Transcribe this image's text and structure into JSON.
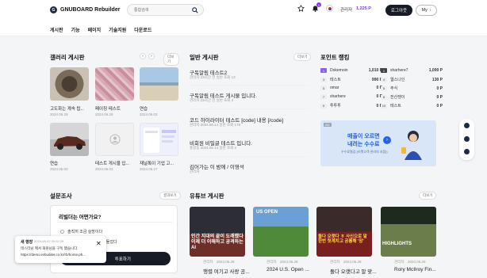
{
  "header": {
    "logo_text": "GNUBOARD Rebuilder",
    "search_placeholder": "통합검색",
    "notification_count": "1",
    "manager_label": "관리자",
    "points": "1,225 P",
    "logout_label": "로그아웃",
    "my_label": "My"
  },
  "nav": [
    "게시판",
    "기능",
    "페이지",
    "기술지원",
    "다운로드"
  ],
  "gallery": {
    "title": "갤러리 게시판",
    "more": "더보기",
    "items": [
      {
        "caption": "고도화는 계속 됩...",
        "date": "2024.06.29"
      },
      {
        "caption": "페이징 테스트",
        "date": "2024.06.28"
      },
      {
        "caption": "연습",
        "date": "2024.06.03"
      },
      {
        "caption": "연습",
        "date": "2024.06.03"
      },
      {
        "caption": "테스트 게시물 입...",
        "date": "2024.06.03"
      },
      {
        "caption": "재널톡이 기업 고...",
        "date": "2024.05.27"
      }
    ]
  },
  "board": {
    "title": "일반 게시판",
    "more": "더보기",
    "posts": [
      {
        "title": "구독알림 테스트2",
        "meta": "관리자   23시간 전   일반   조회 13"
      },
      {
        "title": "구독알림 테스트 게시물 입니다.",
        "meta": "관리자   23시간 전   일반   조회 4"
      },
      {
        "title": "코드 하이라이터 테스트 [code] 내용 [/code]",
        "meta": "관리자   2024.06.14   일반   조회 179"
      },
      {
        "title": "비회원 비밀글 테스트 입니다.",
        "meta": "홍길동   2024.06.14   일반   조회 2"
      },
      {
        "title": "김어가는 이 밤에 / 이영석",
        "meta": "관리자"
      }
    ]
  },
  "ranking": {
    "title": "포인트 랭킹",
    "rows": [
      {
        "num": "1",
        "name": "Dokemoin",
        "pts": "1,010 P"
      },
      {
        "num": "2",
        "name": "sharhere7",
        "pts": "1,000 P"
      },
      {
        "num": "3",
        "name": "테스트",
        "pts": "990 P"
      },
      {
        "num": "4",
        "name": "웹스나인",
        "pts": "130 P"
      },
      {
        "num": "5",
        "name": "omar",
        "pts": "0 P"
      },
      {
        "num": "6",
        "name": "주식",
        "pts": "0 P"
      },
      {
        "num": "7",
        "name": "sharhere",
        "pts": "0 P"
      },
      {
        "num": "8",
        "name": "전산쟁이",
        "pts": "0 P"
      },
      {
        "num": "9",
        "name": "투투투",
        "pts": "0 P"
      },
      {
        "num": "10",
        "name": "테스트",
        "pts": "0 P"
      }
    ]
  },
  "ad": {
    "tag": "AD",
    "headline1": "매출이 오르면",
    "headline2": "내려는 수수료",
    "sub": "수수료절감 (티켓고객 관리의 지점!)"
  },
  "poll": {
    "title": "설문조사",
    "more": "결과보기",
    "question": "리빌더는 어떤가요?",
    "options": [
      "솔직히 조금 실망이다",
      "그런대로 쓸만하다고 만들었다"
    ],
    "vote_label": "투표하기"
  },
  "youtube": {
    "title": "유튜브 게시판",
    "more": "더보기",
    "items": [
      {
        "overlay": "인간 지대의 끝이 도래했다\n이제 더 이해하고 공격하는 AI",
        "author": "관리자",
        "date": "2024.06.29",
        "title": "행렬 여기고 사랑 공..."
      },
      {
        "overlay": "US OPEN",
        "author": "관리자",
        "date": "2024.06.29",
        "title": "2024 U.S. Open ..."
      },
      {
        "overlay": "돌다 오랫다 ㅎ 사신으로 말\n한번 헛계치고 공룡해 '장'",
        "author": "관리자",
        "date": "2024.06.29",
        "title": "돌다 오랫다고 말 맞..."
      },
      {
        "overlay": "HIGHLIGHTS",
        "author": "관리자",
        "date": "2024.06.29",
        "title": "Rory McIlroy Fin..."
      }
    ]
  },
  "toast": {
    "title": "새 행장",
    "time": "2024-08-02 00:02:29",
    "message": "테스터님 께서 화원님을 구독 했습니다.",
    "url": "https://demo.rebuilder.co.kr/rb/home.ph..."
  }
}
